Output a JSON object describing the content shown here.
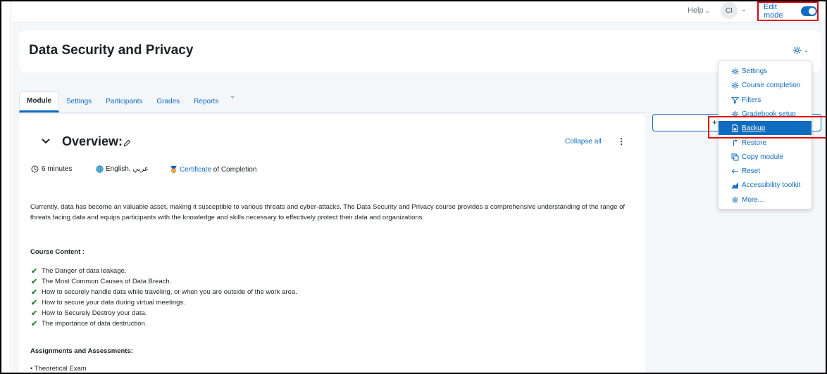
{
  "topnav": {
    "help_label": "Help",
    "avatar_initials": "CI",
    "edit_mode_label": "Edit mode",
    "edit_mode_on": true
  },
  "course": {
    "title": "Data Security and Privacy"
  },
  "tabs": [
    {
      "label": "Module",
      "active": true
    },
    {
      "label": "Settings",
      "active": false
    },
    {
      "label": "Participants",
      "active": false
    },
    {
      "label": "Grades",
      "active": false
    },
    {
      "label": "Reports",
      "active": false
    }
  ],
  "section": {
    "title": "Overview:",
    "collapse_all": "Collapse all",
    "duration": "6 minutes",
    "language": "English, عربي",
    "certificate_link": "Certificate",
    "certificate_suffix": " of Completion",
    "description": "Currently, data has become an valuable asset, making it susceptible to various threats and cyber-attacks. The Data Security and Privacy course provides a comprehensive understanding of the range of threats facing data and equips participants with the knowledge and skills necessary to effectively protect their data and organizations.",
    "content_heading": "Course Content :",
    "content_items": [
      "The Danger of data leakage.",
      "The Most Common Causes of Data Breach.",
      "How to securely handle data while traveling, or when you are outside of the work area.",
      "How to secure your data during virtual meetings.",
      "How to Securely Destroy your data.",
      "The importance of data destruction."
    ],
    "assessments_heading": "Assignments and Assessments:",
    "assessment_first": "• Theoretical Exam"
  },
  "dropdown": {
    "items": [
      {
        "label": "Settings",
        "icon": "gear-icon"
      },
      {
        "label": "Course completion",
        "icon": "gear-icon"
      },
      {
        "label": "Filters",
        "icon": "filter-icon"
      },
      {
        "label": "Gradebook setup",
        "icon": "gear-icon"
      },
      {
        "label": "Backup",
        "icon": "file-icon",
        "active": true
      },
      {
        "label": "Restore",
        "icon": "restore-icon"
      },
      {
        "label": "Copy module",
        "icon": "copy-icon"
      },
      {
        "label": "Reset",
        "icon": "arrow-left-icon"
      },
      {
        "label": "Accessibility toolkit",
        "icon": "chart-icon"
      },
      {
        "label": "More...",
        "icon": "gear-icon"
      }
    ]
  },
  "colors": {
    "primary": "#0f6cbf",
    "highlight_red": "#e0000b",
    "check_green": "#2e8540"
  }
}
